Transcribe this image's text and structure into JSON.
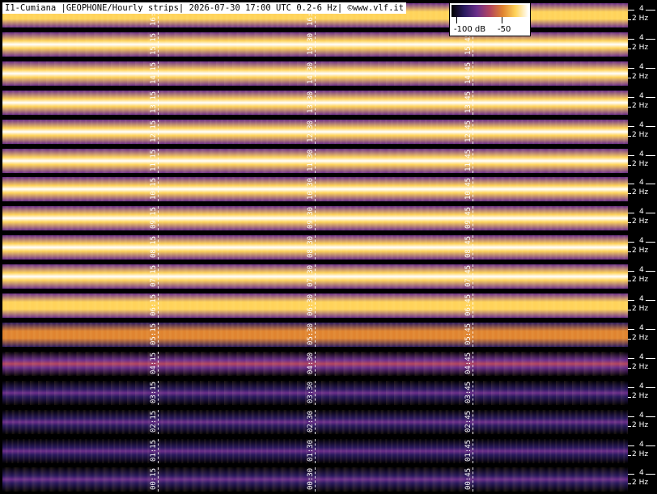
{
  "header": {
    "title": "I1-Cumiana |GEOPHONE/Hourly strips| 2026-07-30 17:00 UTC 0.2-6 Hz| ©www.vlf.it"
  },
  "legend": {
    "labels": [
      "-100 dB",
      "-50"
    ],
    "colors": [
      "#000000",
      "#2a1a5e",
      "#6b2f8a",
      "#b3455e",
      "#e08430",
      "#ffd35a",
      "#ffffff"
    ]
  },
  "axis": {
    "tick_4": "4",
    "tick_2": "2 Hz"
  },
  "chart_data": {
    "type": "heatmap",
    "title": "I1-Cumiana |GEOPHONE/Hourly strips| 2026-07-30 17:00 UTC 0.2-6 Hz| ©www.vlf.it",
    "y_ticks": [
      "4",
      "2 Hz"
    ],
    "colorbar": {
      "min": -100,
      "max": -40,
      "tick_labels": [
        "-100 dB",
        "-50"
      ]
    },
    "grid": true,
    "strips": [
      {
        "times": [
          "16:15",
          "16:30",
          "16:45"
        ],
        "level": 0.78
      },
      {
        "times": [
          "15:15",
          "15:30",
          "15:45"
        ],
        "level": 0.82
      },
      {
        "times": [
          "14:15",
          "14:30",
          "14:45"
        ],
        "level": 0.8
      },
      {
        "times": [
          "13:15",
          "13:30",
          "13:45"
        ],
        "level": 0.85
      },
      {
        "times": [
          "12:15",
          "12:30",
          "12:45"
        ],
        "level": 0.8
      },
      {
        "times": [
          "11:15",
          "11:30",
          "11:45"
        ],
        "level": 0.82
      },
      {
        "times": [
          "10:15",
          "10:30",
          "10:45"
        ],
        "level": 0.84
      },
      {
        "times": [
          "09:15",
          "09:30",
          "09:45"
        ],
        "level": 0.82
      },
      {
        "times": [
          "08:15",
          "08:30",
          "08:45"
        ],
        "level": 0.84
      },
      {
        "times": [
          "07:15",
          "07:30",
          "07:45"
        ],
        "level": 0.82
      },
      {
        "times": [
          "06:15",
          "06:30",
          "06:45"
        ],
        "level": 0.75
      },
      {
        "times": [
          "05:15",
          "05:30",
          "05:45"
        ],
        "level": 0.62
      },
      {
        "times": [
          "04:15",
          "04:30",
          "04:45"
        ],
        "level": 0.32
      },
      {
        "times": [
          "03:15",
          "03:30",
          "03:45"
        ],
        "level": 0.22
      },
      {
        "times": [
          "02:15",
          "02:30",
          "02:45"
        ],
        "level": 0.18
      },
      {
        "times": [
          "01:15",
          "01:30",
          "01:45"
        ],
        "level": 0.15
      },
      {
        "times": [
          "00:15",
          "00:30",
          "00:45"
        ],
        "level": 0.16
      }
    ]
  }
}
